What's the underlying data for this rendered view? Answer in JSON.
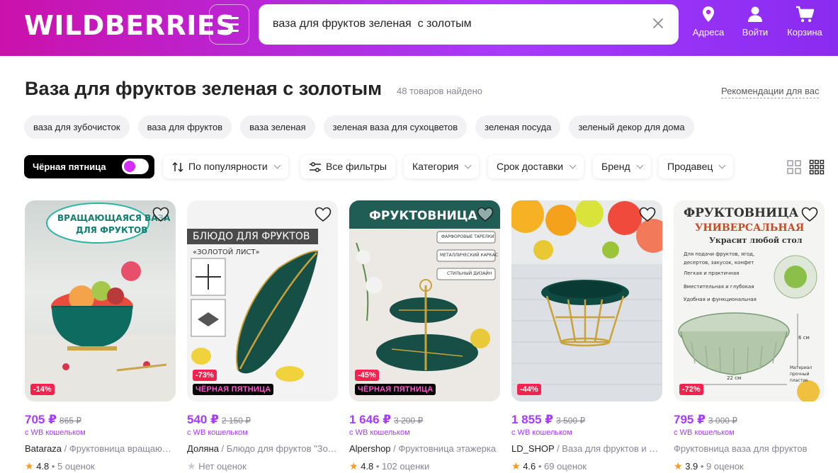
{
  "header": {
    "logo": "WILDBERRIES",
    "search_value": "ваза для фруктов зеленая  с золотым",
    "addresses_label": "Адреса",
    "login_label": "Войти",
    "cart_label": "Корзина"
  },
  "page": {
    "title": "Ваза для фруктов зеленая с золотым",
    "count": "48 товаров найдено",
    "recommendations": "Рекомендации для вас"
  },
  "chips": [
    "ваза для зубочисток",
    "ваза для фруктов",
    "ваза зеленая",
    "зеленая ваза для сухоцветов",
    "зеленая посуда",
    "зеленый декор для дома"
  ],
  "filters": {
    "black_friday": "Чёрная пятница",
    "sort": "По популярности",
    "all_filters": "Все фильтры",
    "category": "Категория",
    "delivery": "Срок доставки",
    "brand": "Бренд",
    "seller": "Продавец"
  },
  "products": [
    {
      "discount": "-14%",
      "black_friday": "",
      "price": "705 ₽",
      "old_price": "865 ₽",
      "wallet": "с WB кошельком",
      "seller": "Bataraza",
      "name": " / Фруктовница вращающаяся",
      "rating": "4.8",
      "reviews": "5 оценок",
      "img_text": [
        "ВРАЩАЮЩАЯСЯ ВАЗА",
        "ДЛЯ ФРУКТОВ"
      ]
    },
    {
      "discount": "-73%",
      "black_friday": "ЧЁРНАЯ ПЯТНИЦА",
      "price": "540 ₽",
      "old_price": "2 150 ₽",
      "wallet": "с WB кошельком",
      "seller": "Доляна",
      "name": " / Блюдо для фруктов \"Золотой лист\"",
      "rating": "",
      "reviews": "Нет оценок",
      "img_text": [
        "БЛЮДО ДЛЯ ФРУКТОВ",
        "«ЗОЛОТОЙ ЛИСТ»"
      ]
    },
    {
      "discount": "-45%",
      "black_friday": "ЧЁРНАЯ ПЯТНИЦА",
      "price": "1 646 ₽",
      "old_price": "3 200 ₽",
      "wallet": "с WB кошельком",
      "seller": "Alpershop",
      "name": " / Фруктовница этажерка",
      "rating": "4.8",
      "reviews": "102 оценки",
      "img_text": [
        "ФРУКТОВНИЦА",
        "ФАРФОРОВЫЕ ТАРЕЛКИ",
        "МЕТАЛЛИЧЕСКИЙ КАРКАС",
        "СТИЛЬНЫЙ ДИЗАЙН"
      ]
    },
    {
      "discount": "-44%",
      "black_friday": "",
      "price": "1 855 ₽",
      "old_price": "3 500 ₽",
      "wallet": "с WB кошельком",
      "seller": "LD_SHOP",
      "name": " / Ваза для фруктов и конфет",
      "rating": "4.6",
      "reviews": "69 оценок",
      "img_text": []
    },
    {
      "discount": "-72%",
      "black_friday": "",
      "price": "795 ₽",
      "old_price": "3 000 ₽",
      "wallet": "с WB кошельком",
      "seller": "",
      "name": "Фруктовница ваза для фруктов",
      "rating": "3.9",
      "reviews": "9 оценок",
      "img_text": [
        "ФРУКТОВНИЦА",
        "УНИВЕРСАЛЬНАЯ",
        "Украсит любой стол",
        "Для подачи фруктов, ягод, десертов, закусок, конфет",
        "Легкая и практичная",
        "Вместительная и глубокая",
        "Удобная и функциональная",
        "22 см",
        "6 см",
        "Материал прочный пластик"
      ]
    }
  ],
  "colors": {
    "brand_start": "#cb11ab",
    "brand_end": "#a73afd",
    "price": "#a73afd",
    "discount": "#f4224e"
  }
}
